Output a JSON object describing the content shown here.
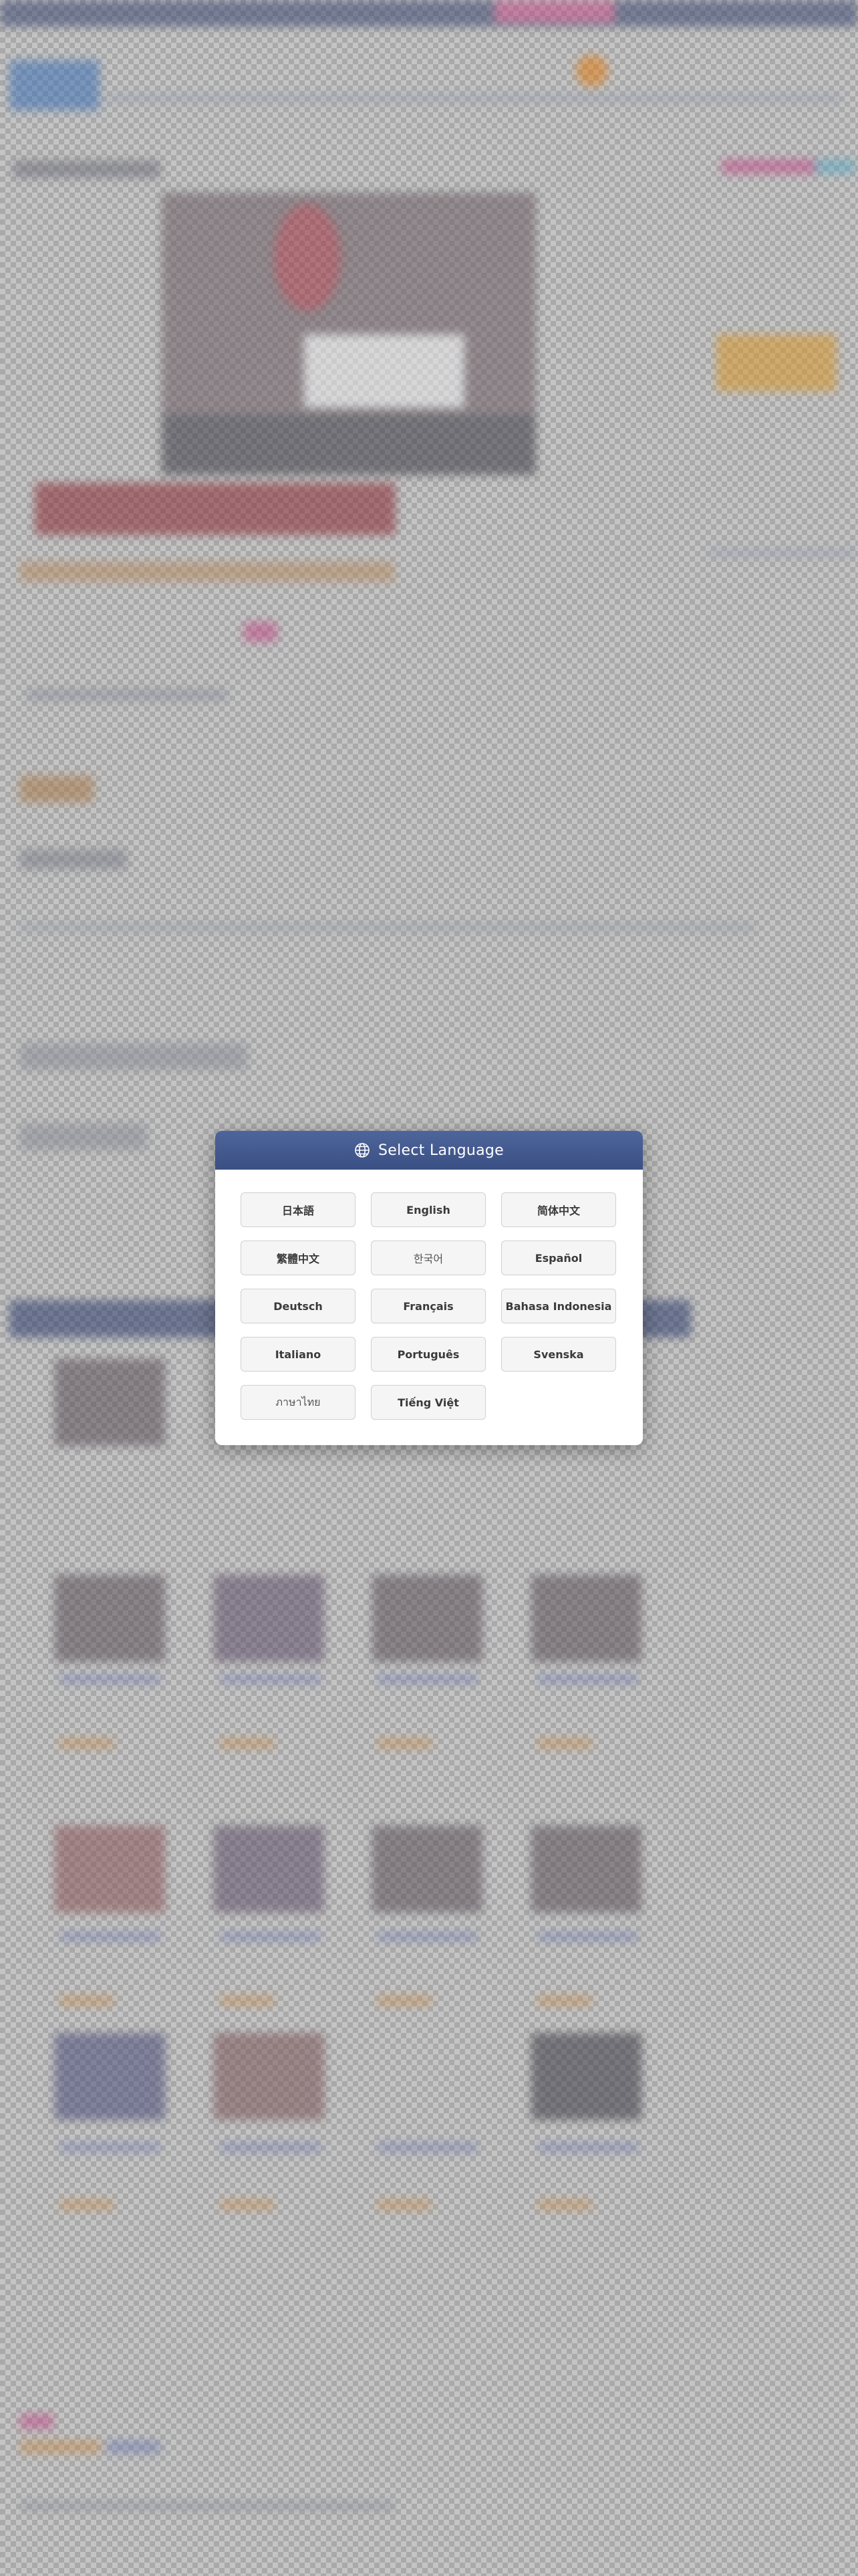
{
  "modal": {
    "title": "Select Language",
    "icon": "globe-icon",
    "header_color": "#40558a",
    "languages": [
      {
        "label": "日本語"
      },
      {
        "label": "English"
      },
      {
        "label": "简体中文"
      },
      {
        "label": "繁體中文"
      },
      {
        "label": "한국어"
      },
      {
        "label": "Español"
      },
      {
        "label": "Deutsch"
      },
      {
        "label": "Français"
      },
      {
        "label": "Bahasa Indonesia"
      },
      {
        "label": "Italiano"
      },
      {
        "label": "Português"
      },
      {
        "label": "Svenska"
      },
      {
        "label": "ภาษาไทย"
      },
      {
        "label": "Tiếng Việt"
      }
    ]
  }
}
